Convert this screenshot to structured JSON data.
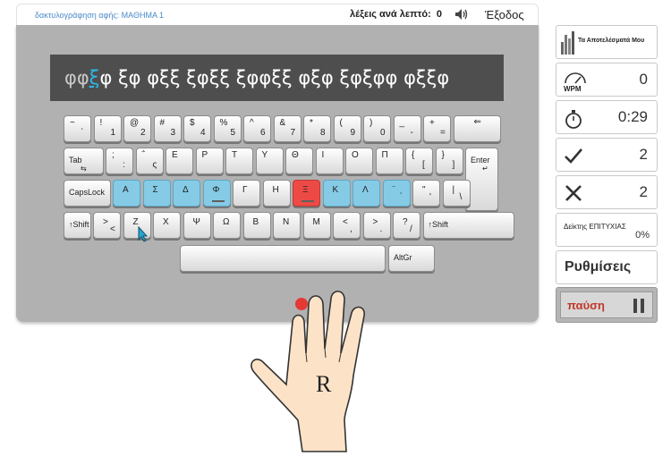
{
  "header": {
    "lesson_title": "δακτυλογράφηση αφής: ΜΑΘΗΜΑ 1",
    "wpm_label": "λέξεις ανά λεπτό:",
    "wpm_value": "0",
    "exit_label": "Έξοδος"
  },
  "practice": {
    "typed": "φφ",
    "current": "ξ",
    "rest": "φ ξφ φξξ ξφξξ ξφφξξ φξφ ξφξφφ φξξφ"
  },
  "keyboard": {
    "row1": [
      {
        "top": "~",
        "bottom": "`"
      },
      {
        "top": "!",
        "bottom": "1"
      },
      {
        "top": "@",
        "bottom": "2"
      },
      {
        "top": "#",
        "bottom": "3"
      },
      {
        "top": "$",
        "bottom": "4"
      },
      {
        "top": "%",
        "bottom": "5"
      },
      {
        "top": "^",
        "bottom": "6"
      },
      {
        "top": "&",
        "bottom": "7"
      },
      {
        "top": "*",
        "bottom": "8"
      },
      {
        "top": "(",
        "bottom": "9"
      },
      {
        "top": ")",
        "bottom": "0"
      },
      {
        "top": "_",
        "bottom": "-"
      },
      {
        "top": "+",
        "bottom": "="
      }
    ],
    "backspace": "⇐",
    "tab": "Tab",
    "tab_sub": "⇆",
    "row2": [
      {
        "top": ";",
        "bottom": ":"
      },
      {
        "top": "΅",
        "bottom": "ς"
      },
      {
        "top": "Ε",
        "bottom": ""
      },
      {
        "top": "Ρ",
        "bottom": ""
      },
      {
        "top": "Τ",
        "bottom": ""
      },
      {
        "top": "Υ",
        "bottom": ""
      },
      {
        "top": "Θ",
        "bottom": ""
      },
      {
        "top": "Ι",
        "bottom": ""
      },
      {
        "top": "Ο",
        "bottom": ""
      },
      {
        "top": "Π",
        "bottom": ""
      },
      {
        "top": "{",
        "bottom": "["
      },
      {
        "top": "}",
        "bottom": "]"
      }
    ],
    "enter": "Enter",
    "enter_sub": "↵",
    "capslock": "CapsLock",
    "row3": [
      {
        "top": "Α",
        "bottom": "",
        "color": "blue"
      },
      {
        "top": "Σ",
        "bottom": "",
        "color": "blue"
      },
      {
        "top": "Δ",
        "bottom": "",
        "color": "blue"
      },
      {
        "top": "Φ",
        "bottom": "",
        "color": "blue",
        "home": true
      },
      {
        "top": "Γ",
        "bottom": "",
        "color": "none"
      },
      {
        "top": "Η",
        "bottom": "",
        "color": "none"
      },
      {
        "top": "Ξ",
        "bottom": "",
        "color": "red",
        "home": true
      },
      {
        "top": "Κ",
        "bottom": "",
        "color": "blue"
      },
      {
        "top": "Λ",
        "bottom": "",
        "color": "blue"
      },
      {
        "top": "¨",
        "bottom": "΄",
        "color": "blue"
      },
      {
        "top": "\"",
        "bottom": "'",
        "color": "none"
      },
      {
        "top": "|",
        "bottom": "\\",
        "color": "none"
      }
    ],
    "lshift": "↑Shift",
    "row4": [
      {
        "top": ">",
        "bottom": "<"
      },
      {
        "top": "Ζ",
        "bottom": ""
      },
      {
        "top": "Χ",
        "bottom": ""
      },
      {
        "top": "Ψ",
        "bottom": ""
      },
      {
        "top": "Ω",
        "bottom": ""
      },
      {
        "top": "Β",
        "bottom": ""
      },
      {
        "top": "Ν",
        "bottom": ""
      },
      {
        "top": "Μ",
        "bottom": ""
      },
      {
        "top": "<",
        "bottom": ","
      },
      {
        "top": ">",
        "bottom": "."
      },
      {
        "top": "?",
        "bottom": "/"
      }
    ],
    "rshift": "↑Shift",
    "altgr": "AltGr"
  },
  "hand": {
    "letter": "R"
  },
  "sidebar": {
    "results_label": "Τα Αποτελέσματά Μου",
    "wpm_badge": "WPM",
    "wpm_value": "0",
    "time_value": "0:29",
    "correct_value": "2",
    "errors_value": "2",
    "accuracy_label": "Δείκτης ΕΠΙΤΥΧΙΑΣ",
    "accuracy_value": "0%",
    "settings_label": "Ρυθμίσεις",
    "pause_label": "παύση"
  },
  "colors": {
    "panel": "#b1b1b1",
    "text_strip": "#4e4e4e",
    "finger_blue": "#86cbe6",
    "target_red": "#ee4a45",
    "pause_text": "#c0392b"
  },
  "icons": {
    "speaker": "speaker-icon",
    "stopwatch": "stopwatch-icon",
    "check": "check-icon",
    "cross": "cross-icon",
    "pause": "pause-icon",
    "cursor": "mouse-cursor-icon"
  }
}
